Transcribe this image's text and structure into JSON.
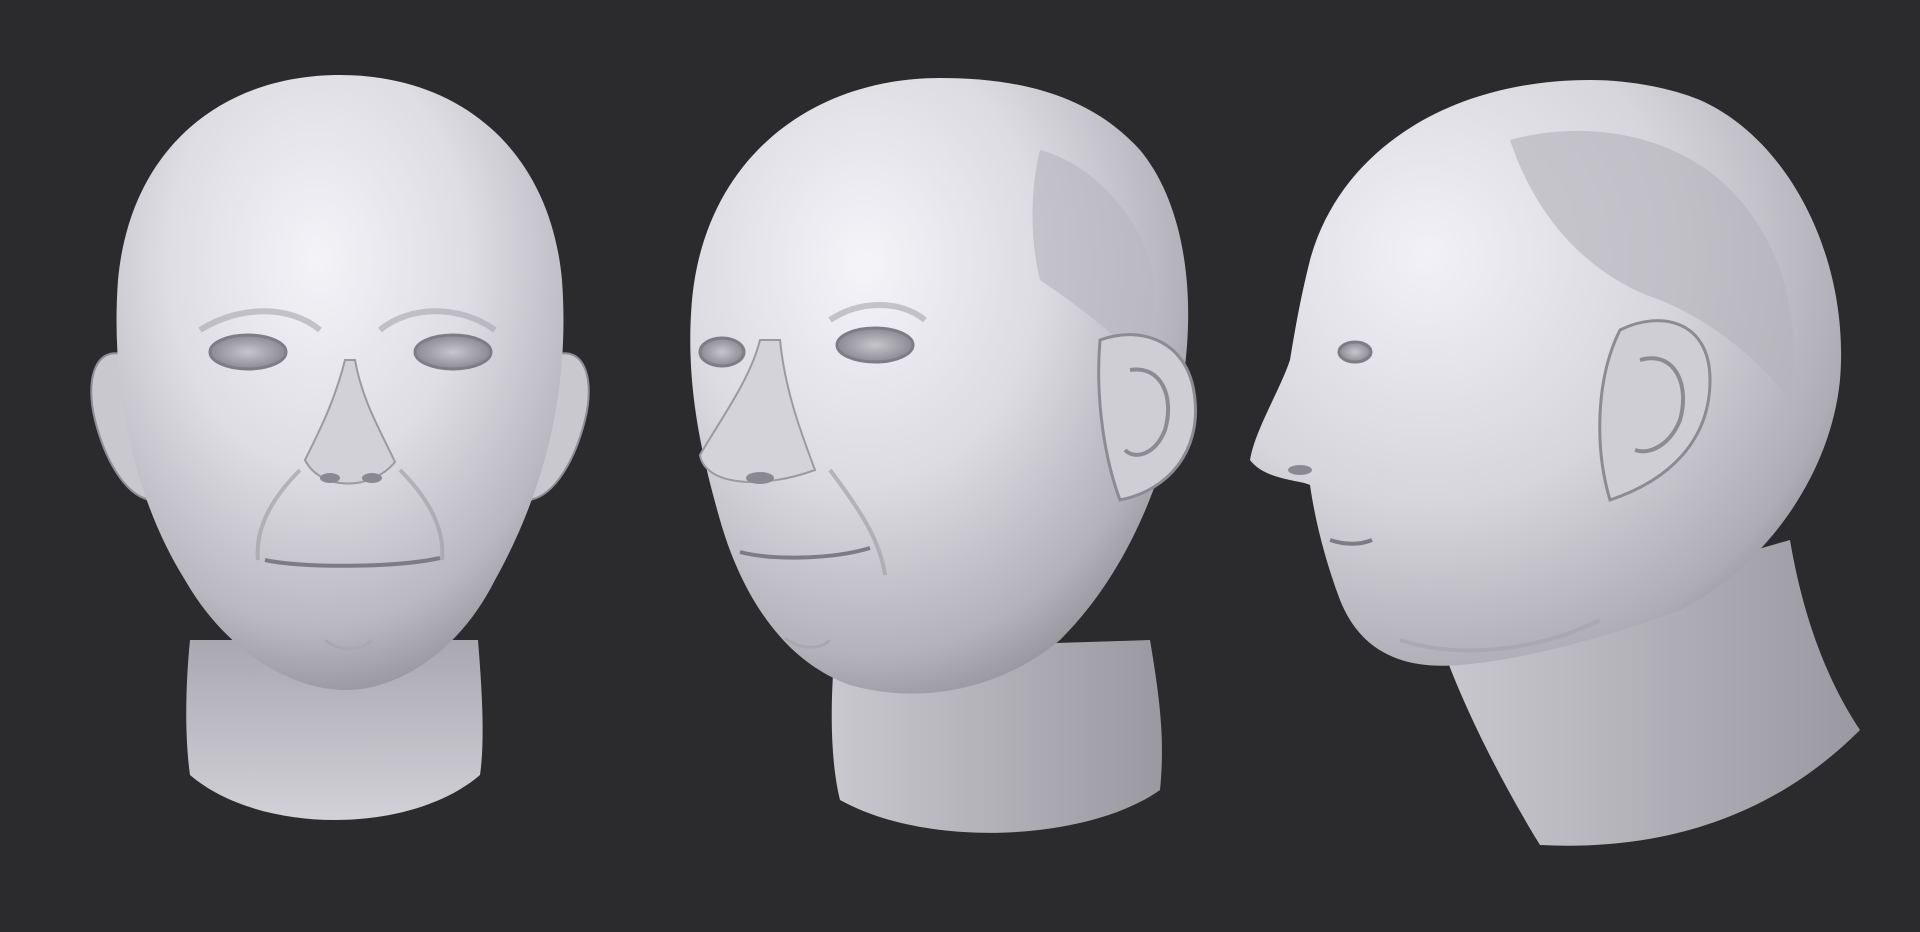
{
  "scene": {
    "background_color": "#2b2b2d",
    "material_color": "#d9d8df",
    "views": [
      {
        "name": "front",
        "icon": "sculpted-head-front"
      },
      {
        "name": "three-quarter",
        "icon": "sculpted-head-three-quarter"
      },
      {
        "name": "profile",
        "icon": "sculpted-head-profile"
      }
    ]
  }
}
